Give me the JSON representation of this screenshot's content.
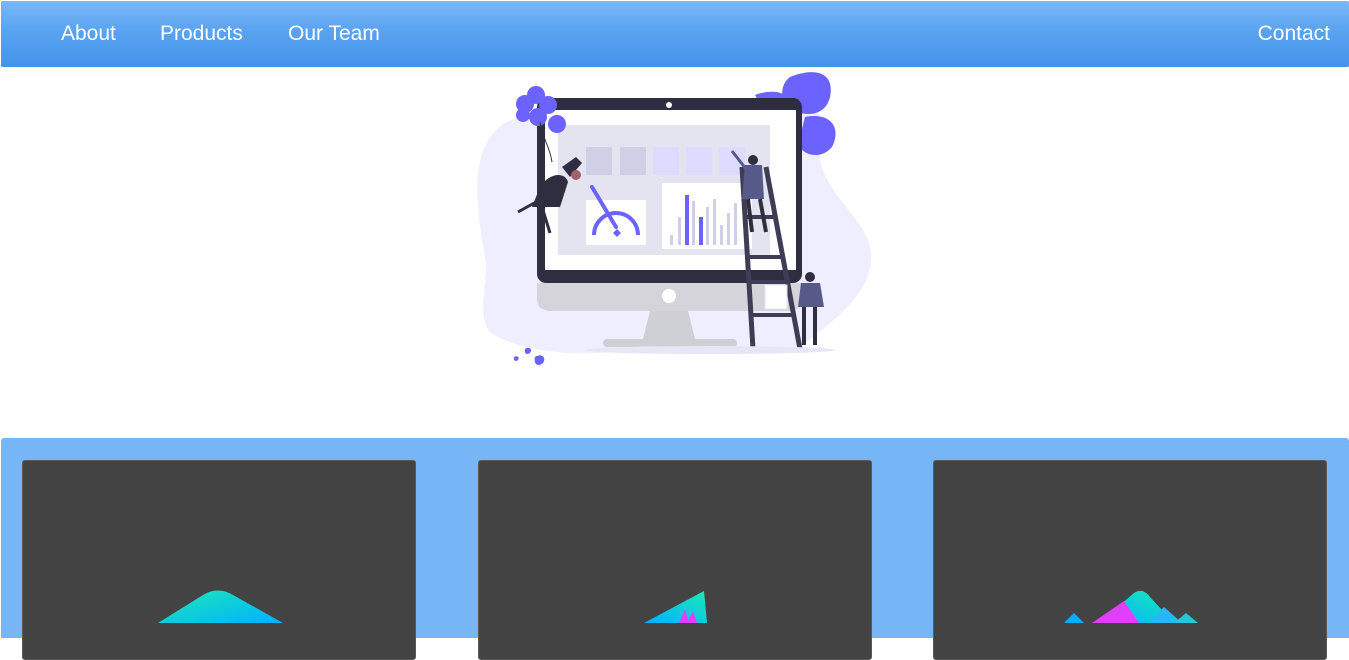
{
  "nav": {
    "links": [
      "About",
      "Products",
      "Our Team"
    ],
    "contact": "Contact"
  },
  "hero": {
    "illustration": "dashboard-team-illustration"
  },
  "products": {
    "cards": [
      {
        "icon": "product-1-icon"
      },
      {
        "icon": "product-2-icon"
      },
      {
        "icon": "product-3-icon"
      }
    ]
  },
  "colors": {
    "nav_top": "#7ab8f7",
    "nav_bottom": "#4493ea",
    "section_bg": "#76b6f6",
    "card_bg": "#434343",
    "accent_purple": "#6c63ff"
  }
}
